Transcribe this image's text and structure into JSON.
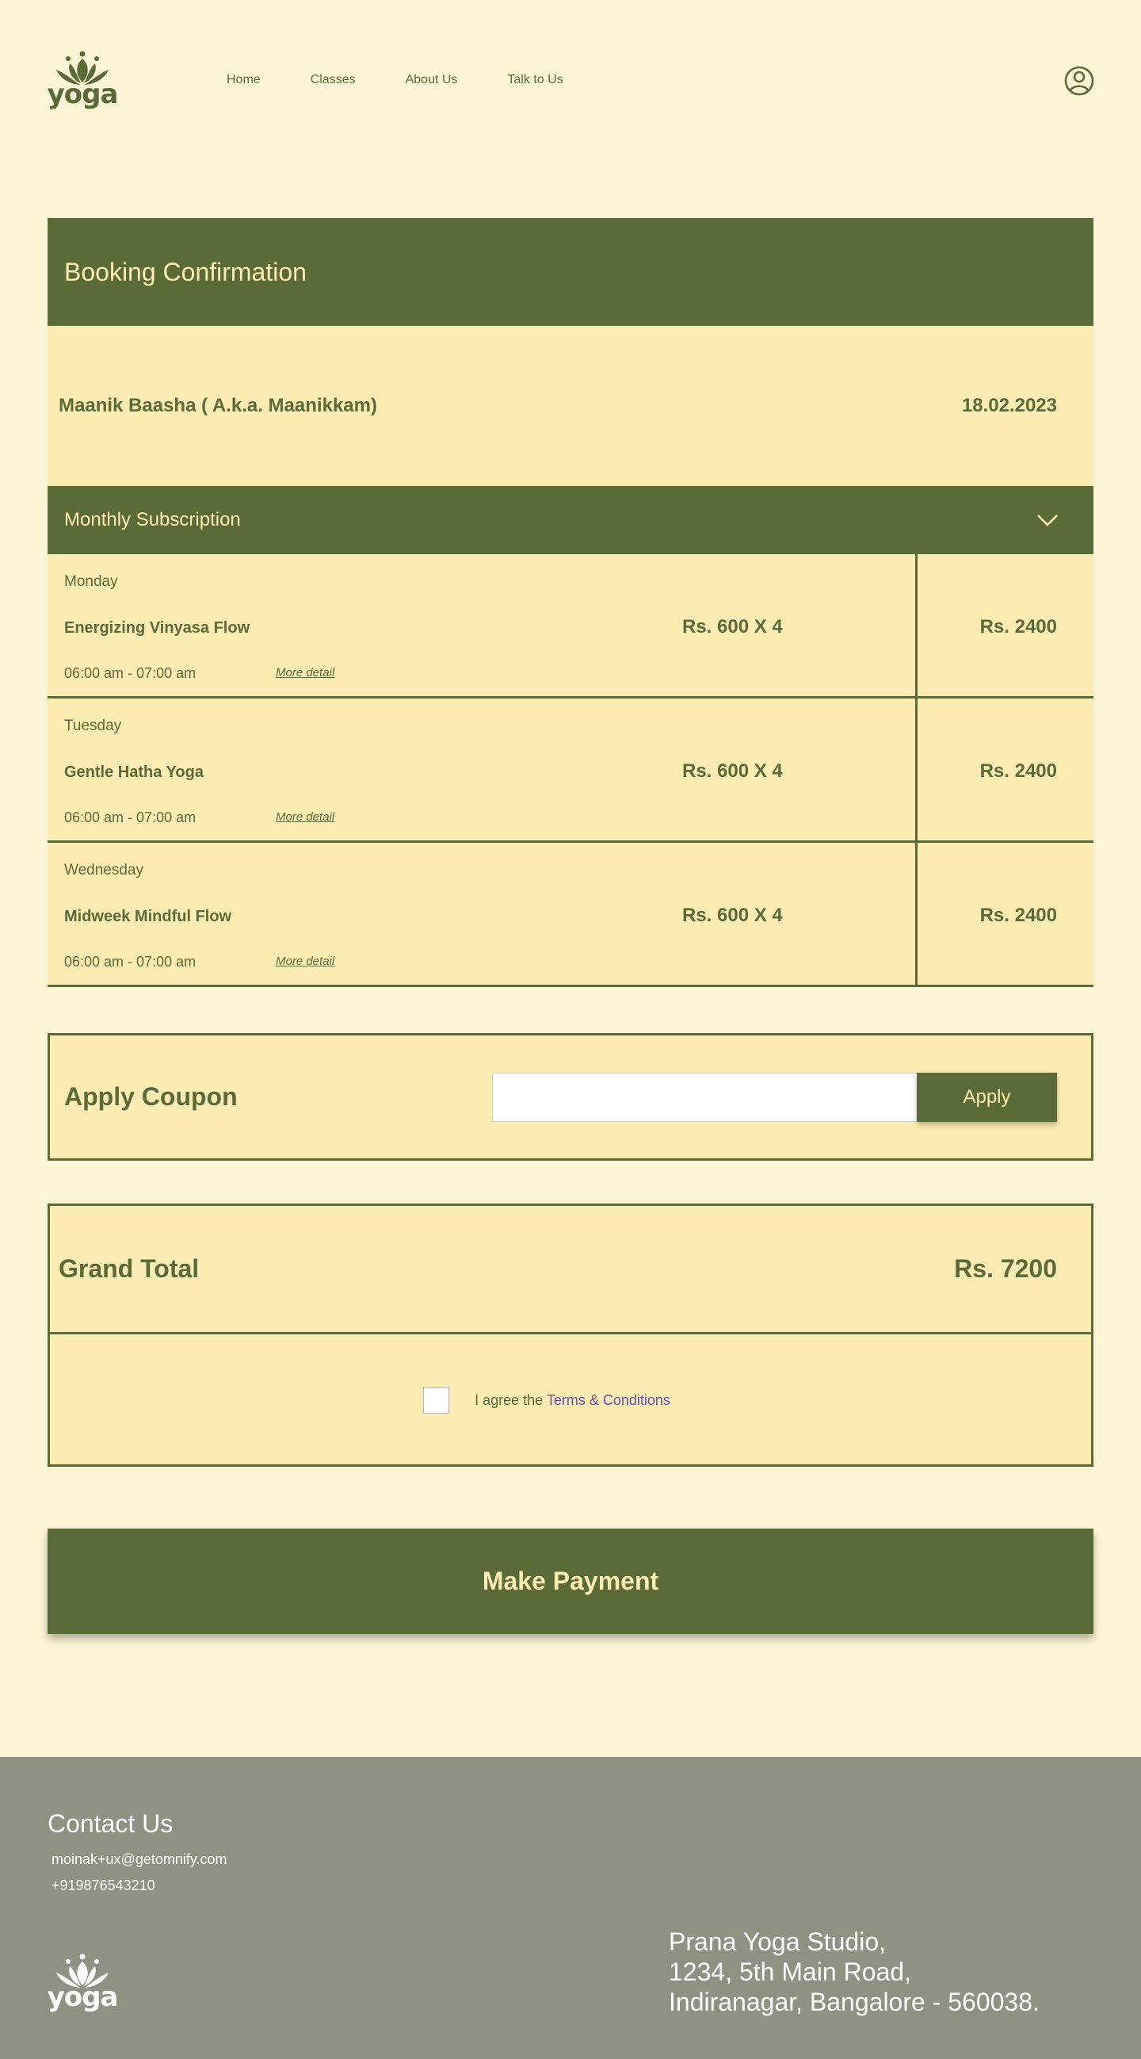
{
  "brand": {
    "logo_text": "yoga"
  },
  "nav": {
    "items": [
      "Home",
      "Classes",
      "About Us",
      "Talk to Us"
    ]
  },
  "booking": {
    "title": "Booking Confirmation",
    "customer_name": "Maanik Baasha ( A.k.a. Maanikkam)",
    "date": "18.02.2023",
    "plan": "Monthly Subscription"
  },
  "classes": [
    {
      "day": "Monday",
      "name": "Energizing Vinyasa Flow",
      "time": "06:00 am - 07:00 am",
      "more": "More detail",
      "unit": "Rs. 600 X 4",
      "total": "Rs. 2400"
    },
    {
      "day": "Tuesday",
      "name": "Gentle Hatha Yoga",
      "time": "06:00 am - 07:00 am",
      "more": "More detail",
      "unit": "Rs. 600 X 4",
      "total": "Rs. 2400"
    },
    {
      "day": "Wednesday",
      "name": "Midweek Mindful Flow",
      "time": "06:00 am - 07:00 am",
      "more": "More detail",
      "unit": "Rs. 600 X 4",
      "total": "Rs. 2400"
    }
  ],
  "coupon": {
    "title": "Apply Coupon",
    "value": "",
    "button": "Apply"
  },
  "grand_total": {
    "label": "Grand Total",
    "value": "Rs. 7200"
  },
  "agree": {
    "prefix": "I agree the ",
    "link": "Terms & Conditions"
  },
  "payment": {
    "button": "Make Payment"
  },
  "footer": {
    "title": "Contact Us",
    "email": "moinak+ux@getomnify.com",
    "phone": "+919876543210",
    "logo_text": "yoga",
    "address": [
      "Prana Yoga Studio,",
      "1234, 5th Main Road,",
      "Indiranagar, Bangalore - 560038."
    ]
  },
  "colors": {
    "primary": "#5a6b38",
    "background": "#fdf5d6",
    "panel": "#fcecb3",
    "footer": "#8e9282",
    "accent_text": "#fdedb2"
  }
}
